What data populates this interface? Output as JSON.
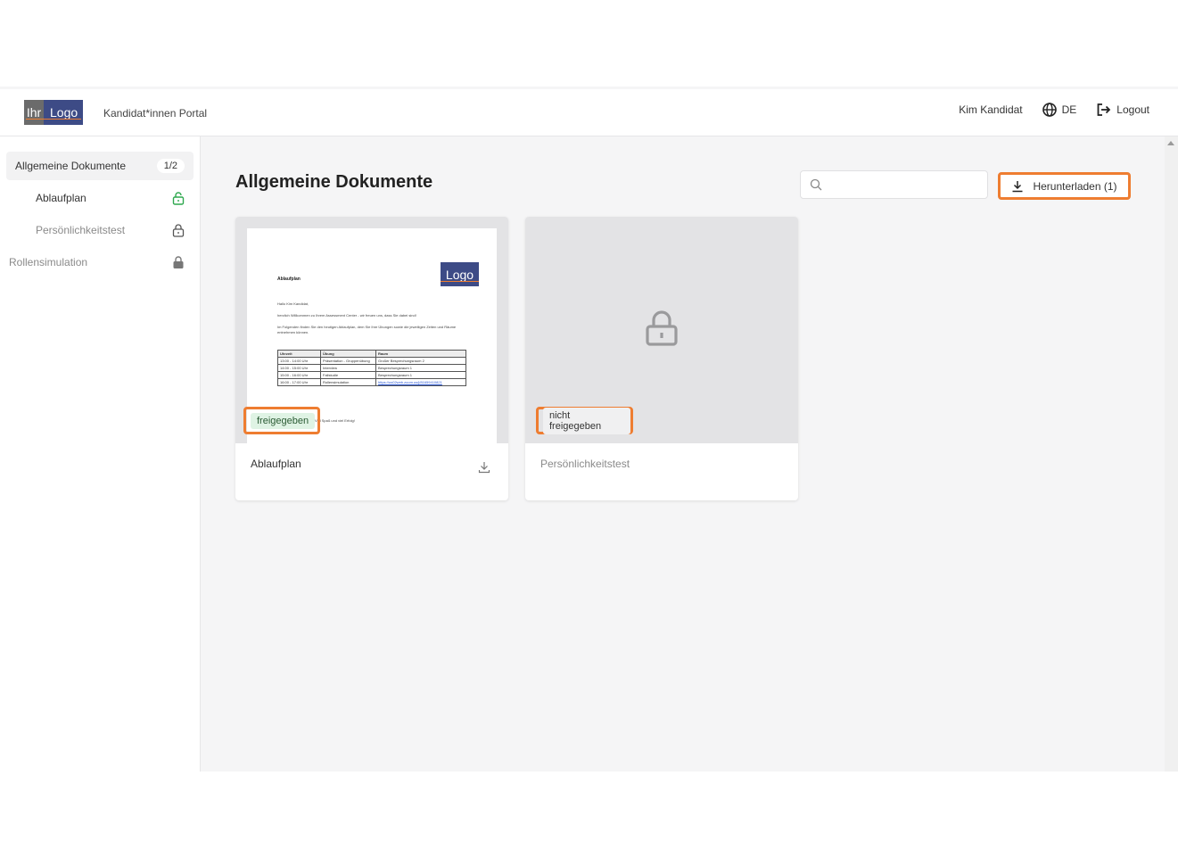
{
  "header": {
    "logo_left": "Ihr",
    "logo_right": "Logo",
    "portal_title": "Kandidat*innen Portal",
    "user_name": "Kim Kandidat",
    "language": "DE",
    "logout_label": "Logout"
  },
  "sidebar": {
    "section_label": "Allgemeine Dokumente",
    "section_count": "1/2",
    "items": [
      {
        "label": "Ablaufplan",
        "lock": "unlocked-green"
      },
      {
        "label": "Persönlichkeitstest",
        "lock": "lock-outline"
      }
    ],
    "root_item": {
      "label": "Rollensimulation",
      "lock": "lock-filled"
    }
  },
  "main": {
    "title": "Allgemeine Dokumente",
    "search_placeholder": "",
    "download_label": "Herunterladen (1)",
    "accent_color": "#ee7d31"
  },
  "cards": [
    {
      "name": "Ablaufplan",
      "status": "freigegeben",
      "preview": {
        "logo": "Logo",
        "title": "Ablaufplan",
        "greeting": "Hallo Kim Kandidat,",
        "line1": "herzlich Willkommen zu Ihrem Assessment Center - wir freuen uns, dass Sie dabei sind!",
        "line2": "Im Folgenden finden Sie den heutigen Ablaufplan, dem Sie Ihre Übungen sowie die jeweiligen Zeiten und Räume entnehmen können.",
        "table_headers": [
          "Uhrzeit",
          "Übung",
          "Raum"
        ],
        "table_rows": [
          [
            "13:00 - 14:00 Uhr",
            "Präsentation - Gruppenübung",
            "Großer Besprechungsraum 2"
          ],
          [
            "14:00 - 15:00 Uhr",
            "Interview",
            "Besprechungsraum 1"
          ],
          [
            "15:00 - 16:00 Uhr",
            "Fallstudie",
            "Besprechungsraum 1"
          ],
          [
            "16:00 - 17:00 Uhr",
            "Rollensimulation",
            "https://us02web.zoom.us/j/81659410821"
          ]
        ],
        "closing": "Viel Spaß und viel Erfolg!"
      }
    },
    {
      "name": "Persönlichkeitstest",
      "status": "nicht freigegeben"
    }
  ]
}
